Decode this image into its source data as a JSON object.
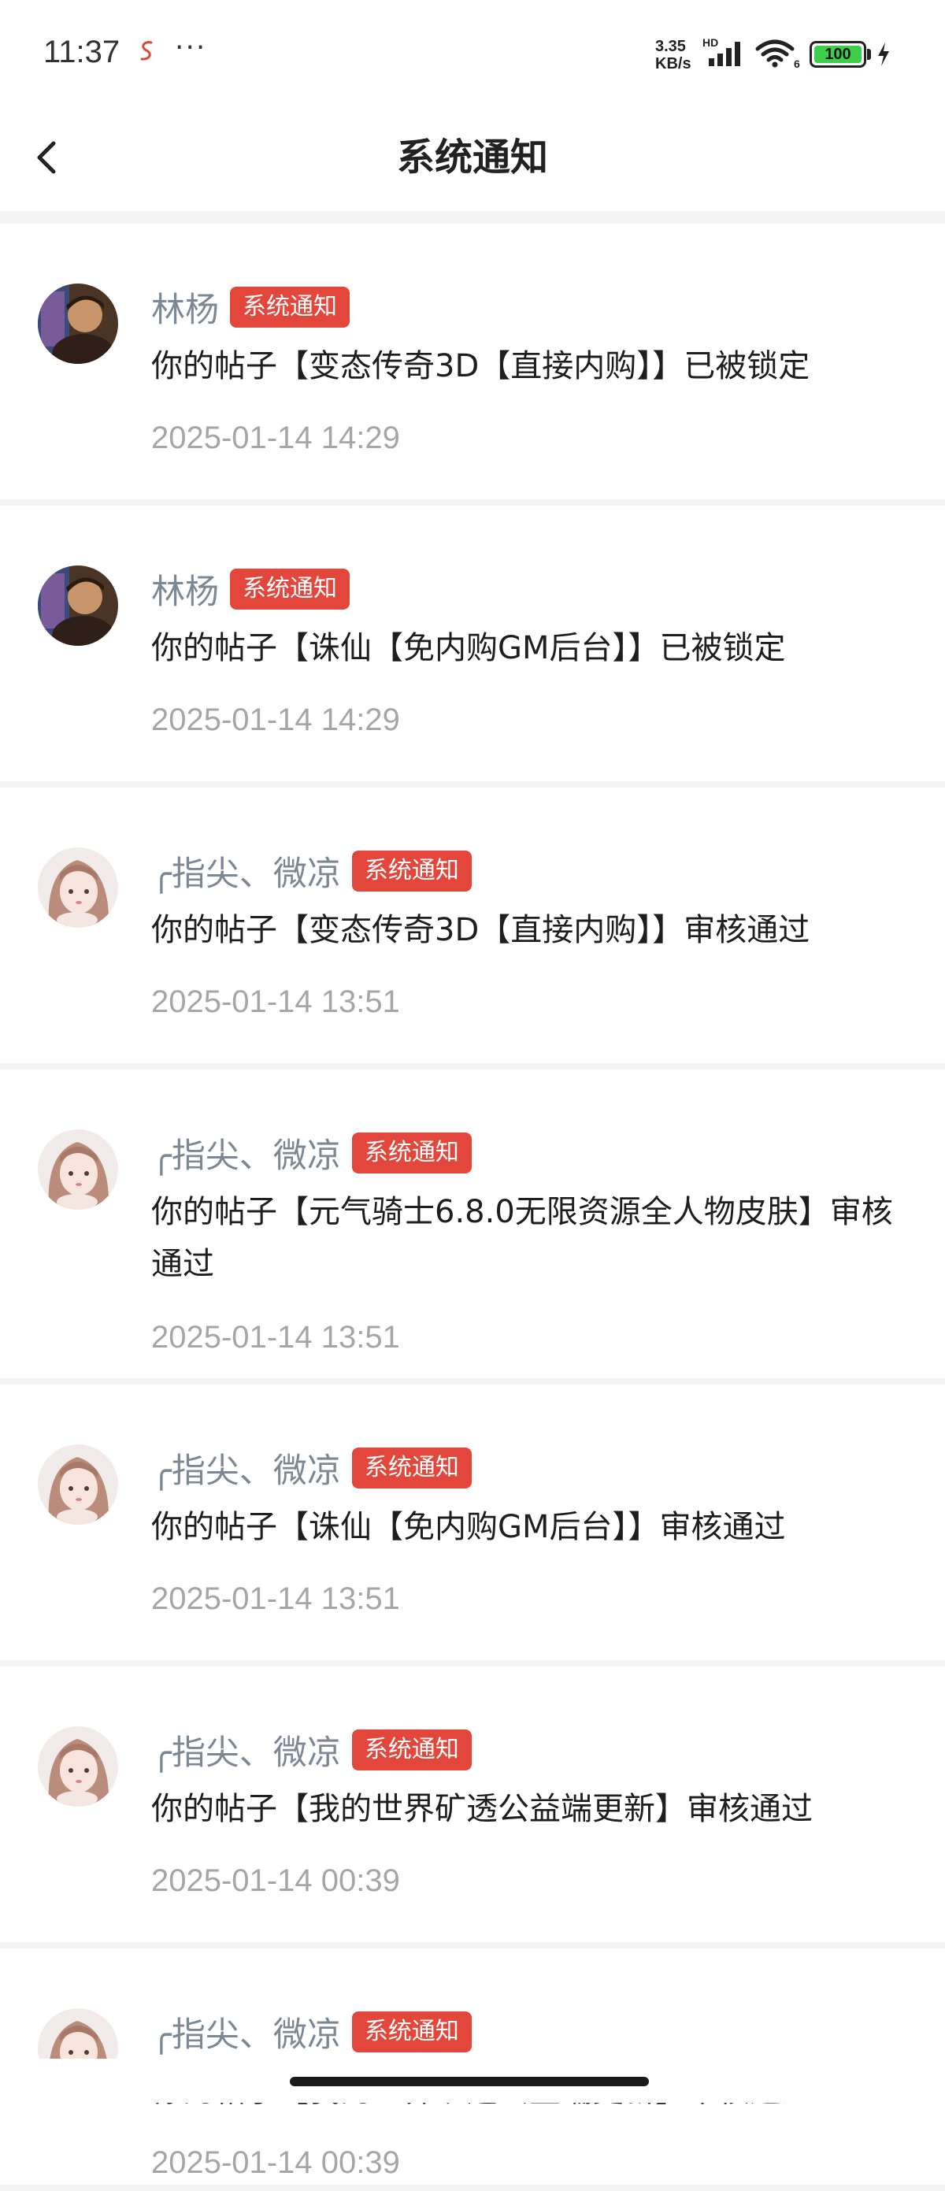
{
  "status_bar": {
    "time": "11:37",
    "speed_value": "3.35",
    "speed_unit": "KB/s",
    "network_label": "HD",
    "wifi_label": "6",
    "battery": "100",
    "app_icon": "red-s-logo",
    "more": "···"
  },
  "header": {
    "title": "系统通知",
    "back_icon": "chevron-left-icon"
  },
  "notifications": [
    {
      "sender": "林杨",
      "badge": "系统通知",
      "message": "你的帖子【变态传奇3D【直接内购】】已被锁定",
      "time": "2025-01-14 14:29",
      "avatar": "man-avatar"
    },
    {
      "sender": "林杨",
      "badge": "系统通知",
      "message": "你的帖子【诛仙【免内购GM后台】】已被锁定",
      "time": "2025-01-14 14:29",
      "avatar": "man-avatar"
    },
    {
      "sender": "╭指尖、微凉",
      "badge": "系统通知",
      "message": "你的帖子【变态传奇3D【直接内购】】审核通过",
      "time": "2025-01-14 13:51",
      "avatar": "girl-avatar"
    },
    {
      "sender": "╭指尖、微凉",
      "badge": "系统通知",
      "message": "你的帖子【元气骑士6.8.0无限资源全人物皮肤】审核通过",
      "time": "2025-01-14 13:51",
      "avatar": "girl-avatar"
    },
    {
      "sender": "╭指尖、微凉",
      "badge": "系统通知",
      "message": "你的帖子【诛仙【免内购GM后台】】审核通过",
      "time": "2025-01-14 13:51",
      "avatar": "girl-avatar"
    },
    {
      "sender": "╭指尖、微凉",
      "badge": "系统通知",
      "message": "你的帖子【我的世界矿透公益端更新】审核通过",
      "time": "2025-01-14 00:39",
      "avatar": "girl-avatar"
    },
    {
      "sender": "╭指尖、微凉",
      "badge": "系统通知",
      "message": "你的帖子【我的世界矿透公益端更新】审核通过",
      "time": "2025-01-14 00:39",
      "avatar": "girl-avatar"
    }
  ],
  "colors": {
    "badge": "#e3463b",
    "sender": "#7d8896",
    "time": "#a6a6a6",
    "background": "#f4f4f4"
  }
}
